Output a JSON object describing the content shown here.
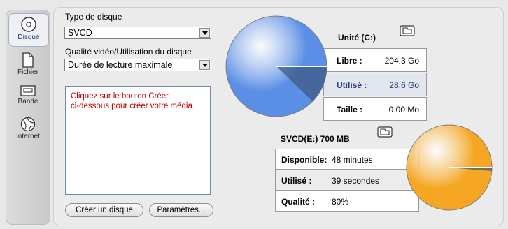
{
  "sidebar": {
    "items": [
      {
        "label": "Disque",
        "icon": "disc-icon",
        "active": true
      },
      {
        "label": "Fichier",
        "icon": "file-icon"
      },
      {
        "label": "Bande",
        "icon": "tape-icon"
      },
      {
        "label": "Internet",
        "icon": "globe-icon"
      }
    ]
  },
  "form": {
    "disc_type_label": "Type de disque",
    "disc_type_value": "SVCD",
    "quality_label": "Qualité vidéo/Utilisation du disque",
    "quality_value": "Durée de lecture maximale",
    "message": "Cliquez sur le bouton Créer\nci-dessous pour créer votre média.",
    "create_button": "Créer un disque",
    "settings_button": "Paramètres..."
  },
  "drive": {
    "title": "Unité (C:)",
    "rows": [
      {
        "key": "Libre :",
        "value": "204.3 Go"
      },
      {
        "key": "Utilisé :",
        "value": "28.6 Go"
      },
      {
        "key": "Taille :",
        "value": "0.00 Mo"
      }
    ],
    "used_fraction": 0.123,
    "color": "#5b8fe6"
  },
  "disc": {
    "title": "SVCD(E:) 700 MB",
    "rows": [
      {
        "key": "Disponible:",
        "value": "48 minutes"
      },
      {
        "key": "Utilisé :",
        "value": "39 secondes"
      },
      {
        "key": "Qualité :",
        "value": "80%"
      }
    ],
    "used_fraction": 0.013,
    "color": "#f5a623"
  },
  "colors": {
    "message": "#c00000",
    "highlight_text": "#1f3a78"
  }
}
